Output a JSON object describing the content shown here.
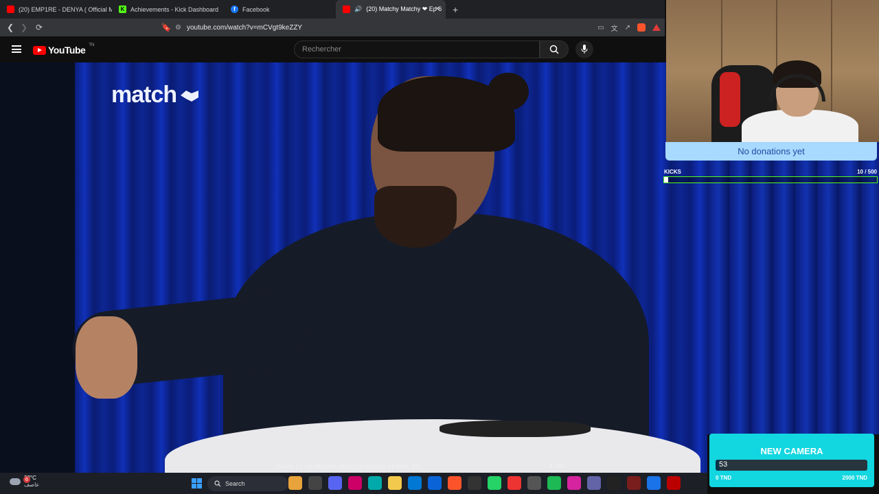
{
  "browser": {
    "tabs": [
      {
        "title": "(20) EMP1RE - DENYA ( Official Music",
        "favicon_color": "#ff0000",
        "active": false
      },
      {
        "title": "Achievements - Kick Dashboard",
        "favicon_color": "#53fc18",
        "active": false
      },
      {
        "title": "Facebook",
        "favicon_color": "#1877f2",
        "active": false
      },
      {
        "title": "(20) Matchy Matchy ❤ Ep 6",
        "favicon_color": "#ff0000",
        "active": true
      }
    ],
    "new_tab": "+",
    "url": "youtube.com/watch?v=mCVgt9keZZY"
  },
  "youtube": {
    "logo_text": "YouTube",
    "region": "TN",
    "search_placeholder": "Rechercher"
  },
  "video": {
    "watermark": "match",
    "subtitle": "GOAL LI YA3RFING MOUCH BECH YEKML XD",
    "timecode": "4 / 60"
  },
  "stream_overlay": {
    "donations_text": "No donations yet",
    "kicks_label": "KICKS",
    "kicks_count": "10  / 500",
    "kicks_progress": 0.02,
    "goal_title": "NEW CAMERA",
    "goal_value": "53",
    "goal_min": "0 TND",
    "goal_max": "2000 TND",
    "goal_progress": 0.0265
  },
  "taskbar": {
    "weather_badge": "6",
    "temperature": "23°C",
    "condition": "عاصف",
    "search_label": "Search",
    "apps": [
      "file-explorer-icon",
      "app-icon",
      "discord-icon",
      "app-icon",
      "edge-icon",
      "folder-icon",
      "store-icon",
      "outlook-icon",
      "brave-icon",
      "obs-icon",
      "whatsapp-icon",
      "chrome-icon",
      "app-icon",
      "spotify-icon",
      "instagram-icon",
      "teams-icon",
      "capcut-icon",
      "app-icon",
      "chrome-icon",
      "app-icon"
    ]
  }
}
